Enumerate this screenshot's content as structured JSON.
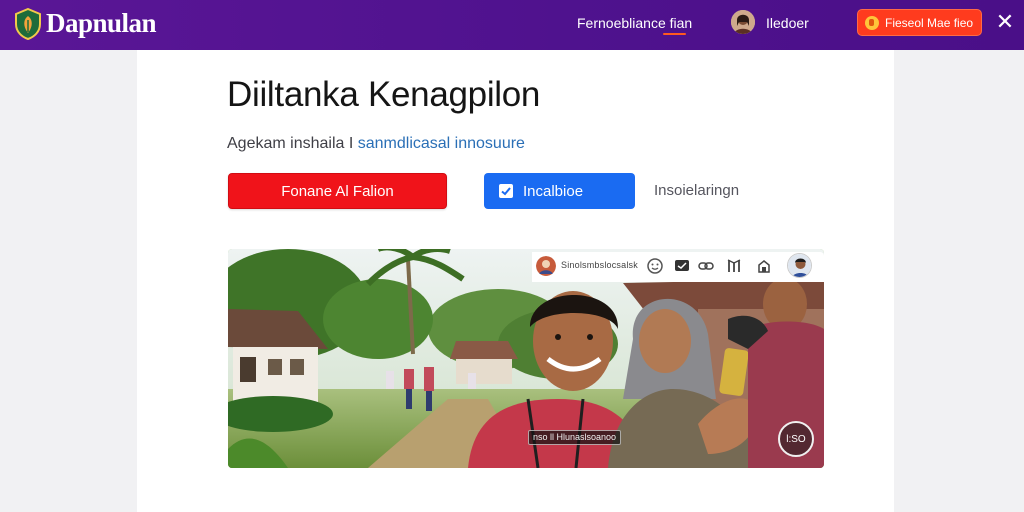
{
  "header": {
    "brand": "Dapnulan",
    "nav_link": "Fernoebliance fian",
    "user_name": "Iledoer",
    "cta_label": "Fieseol Mae fieo",
    "close_symbol": "✕"
  },
  "main": {
    "title": "Diiltanka Kenagpilon",
    "subtitle_plain": "Agekam inshaila I",
    "subtitle_link": "sanmdlicasal innosuure",
    "primary_button": "Fonane Al Falion",
    "secondary_button": "Incalbioe",
    "text_link": "Insoielaringn"
  },
  "media": {
    "toolbar_caption": "Sinolsmbslocsalsk",
    "overlay_caption": "nso ll Hlunaslsoanoo",
    "play_label": "l:SO",
    "icons": [
      "smile-icon",
      "message-icon",
      "link-icon",
      "bookmark-icon",
      "share-icon"
    ]
  },
  "colors": {
    "header": "#5a1696",
    "accent_orange": "#ff3b1e",
    "primary_red": "#f0131a",
    "secondary_blue": "#1a6bf2",
    "link_blue": "#2a6fb6"
  }
}
